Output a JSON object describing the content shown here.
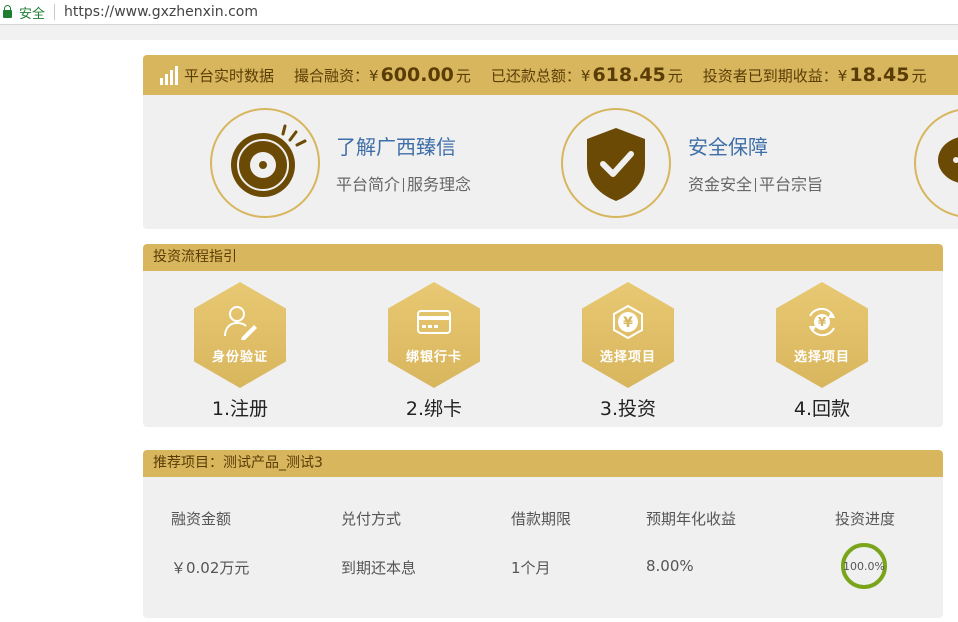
{
  "browser": {
    "secure_label": "安全",
    "url": "https://www.gxzhenxin.com"
  },
  "platform": {
    "title": "平台实时数据",
    "stats": [
      {
        "label": "撮合融资：¥",
        "value": "600.00",
        "unit": "元"
      },
      {
        "label": "已还款总额：¥",
        "value": "618.45",
        "unit": "元"
      },
      {
        "label": "投资者已到期收益：¥",
        "value": "18.45",
        "unit": "元"
      }
    ]
  },
  "about": [
    {
      "icon": "disc-icon",
      "title": "了解广西臻信",
      "links": [
        "平台简介",
        "服务理念"
      ]
    },
    {
      "icon": "shield-check-icon",
      "title": "安全保障",
      "links": [
        "资金安全",
        "平台宗旨"
      ]
    }
  ],
  "process": {
    "title": "投资流程指引",
    "steps": [
      {
        "icon": "user-edit-icon",
        "hex_label": "身份验证",
        "title": "1.注册"
      },
      {
        "icon": "bank-card-icon",
        "hex_label": "绑银行卡",
        "title": "2.绑卡"
      },
      {
        "icon": "yen-hex-icon",
        "hex_label": "选择项目",
        "title": "3.投资"
      },
      {
        "icon": "yen-refresh-icon",
        "hex_label": "选择项目",
        "title": "4.回款"
      }
    ]
  },
  "recommend": {
    "title": "推荐项目：测试产品_测试3",
    "columns": [
      "融资金额",
      "兑付方式",
      "借款期限",
      "预期年化收益",
      "投资进度"
    ],
    "values": [
      "￥0.02万元",
      "到期还本息",
      "1个月",
      "8.00%"
    ],
    "progress_label": "100.0%",
    "progress": 1.0
  },
  "colors": {
    "accent": "#d8b65e",
    "brown": "#6b4a05",
    "link_blue": "#3f6fa8",
    "progress_green": "#7aa51a"
  }
}
